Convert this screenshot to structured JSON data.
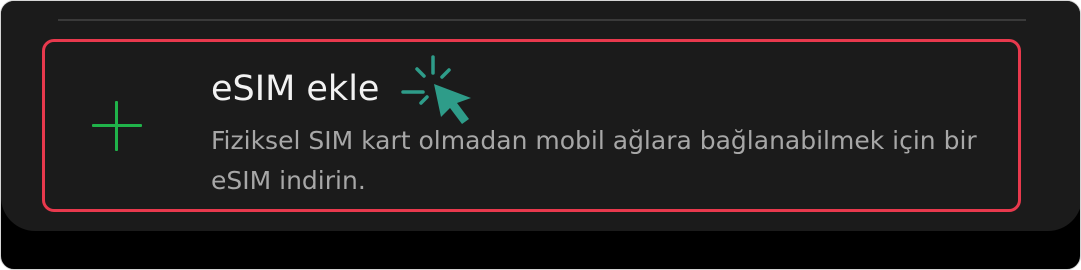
{
  "esim_option": {
    "title": "eSIM ekle",
    "description": "Fiziksel SIM kart olmadan mobil ağlara bağlanabilmek için bir eSIM indirin."
  },
  "icons": {
    "add": "plus-icon",
    "pointer": "click-cursor-icon"
  },
  "colors": {
    "panel_background": "#1b1b1b",
    "highlight_border": "#e8394d",
    "plus_icon": "#20b34a",
    "cursor": "#2e9c89",
    "title_text": "#f2f2f2",
    "description_text": "#a7a7a7"
  }
}
